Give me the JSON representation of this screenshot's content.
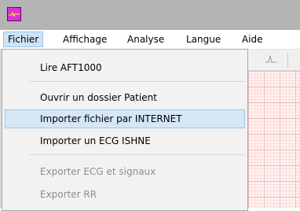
{
  "menubar": {
    "items": [
      {
        "label": "Fichier"
      },
      {
        "label": "Affichage"
      },
      {
        "label": "Analyse"
      },
      {
        "label": "Langue"
      },
      {
        "label": "Aide"
      }
    ]
  },
  "fichier_menu": {
    "items": [
      {
        "label": "Lire AFT1000",
        "enabled": true
      },
      {
        "label": "Ouvrir un dossier Patient",
        "enabled": true
      },
      {
        "label": "Importer fichier par INTERNET",
        "enabled": true,
        "highlighted": true
      },
      {
        "label": "Importer un ECG ISHNE",
        "enabled": true
      },
      {
        "label": "Exporter ECG et signaux",
        "enabled": false
      },
      {
        "label": "Exporter RR",
        "enabled": false
      }
    ]
  },
  "colors": {
    "titlebar": "#b4b4b4",
    "menu_active": "#cde4f7",
    "item_hover": "#d5e6f7",
    "disabled_text": "#8c8c8c",
    "ecg_grid": "#f2b8b8"
  }
}
